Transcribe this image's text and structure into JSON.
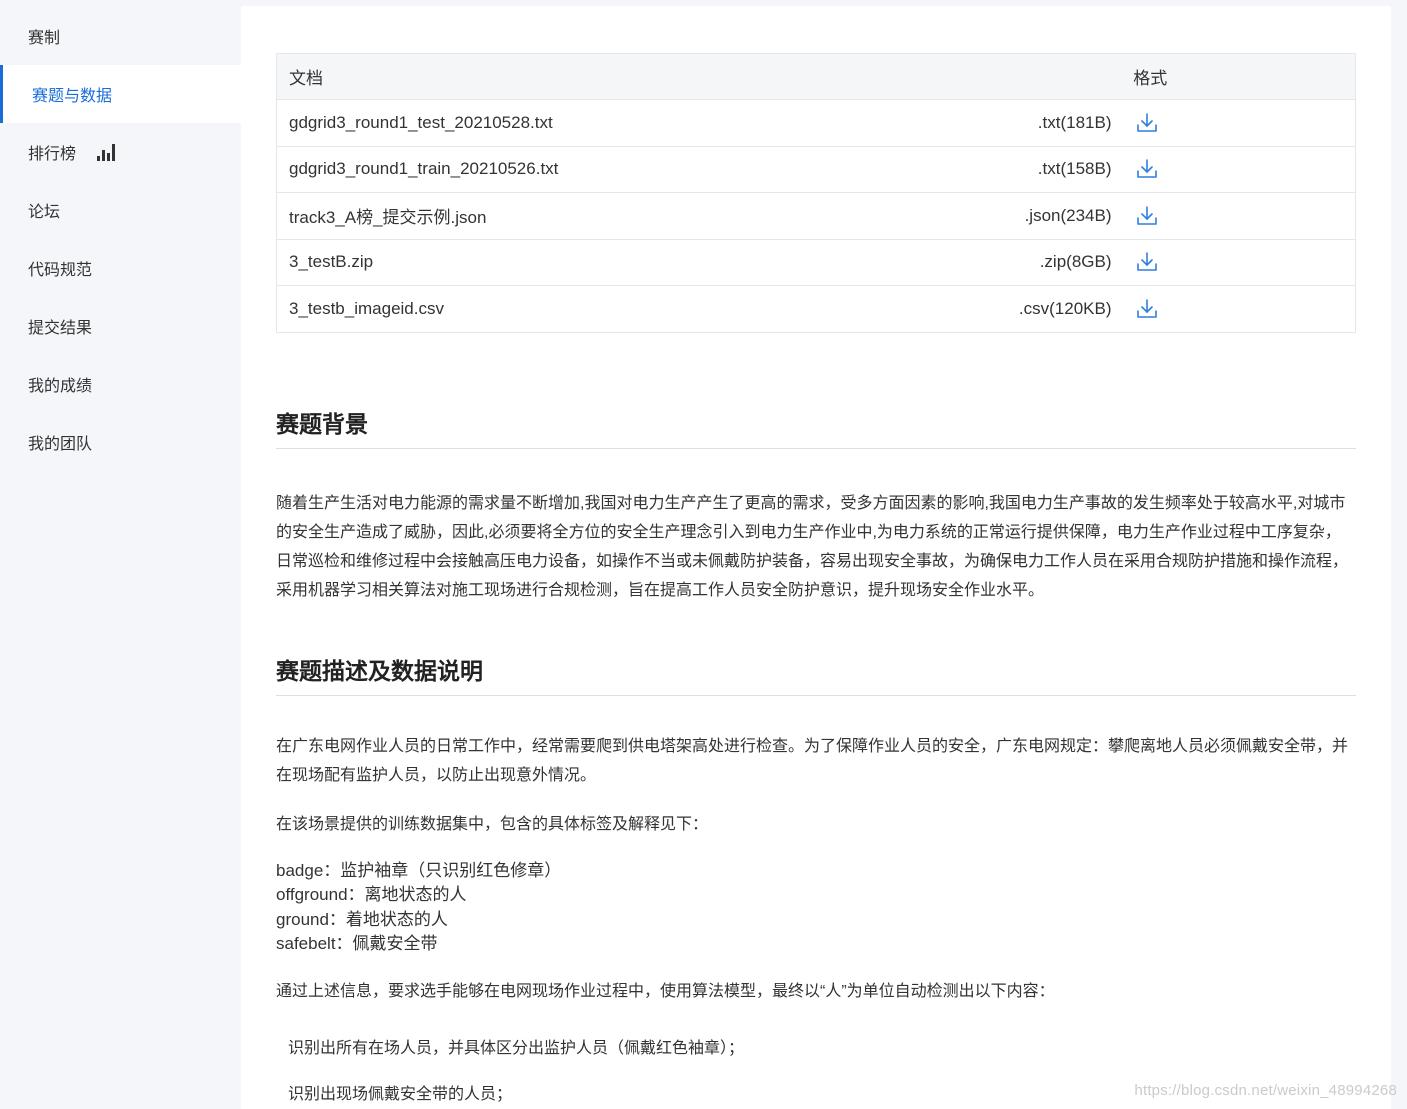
{
  "sidebar": {
    "items": [
      {
        "label": "赛制"
      },
      {
        "label": "赛题与数据"
      },
      {
        "label": "排行榜"
      },
      {
        "label": "论坛"
      },
      {
        "label": "代码规范"
      },
      {
        "label": "提交结果"
      },
      {
        "label": "我的成绩"
      },
      {
        "label": "我的团队"
      }
    ],
    "active_index": 1,
    "accent_color": "#1a6dd8"
  },
  "files_table": {
    "headers": {
      "doc": "文档",
      "format": "格式"
    },
    "rows": [
      {
        "name": "gdgrid3_round1_test_20210528.txt",
        "format": ".txt(181B)"
      },
      {
        "name": "gdgrid3_round1_train_20210526.txt",
        "format": ".txt(158B)"
      },
      {
        "name": "track3_A榜_提交示例.json",
        "format": ".json(234B)"
      },
      {
        "name": "3_testB.zip",
        "format": ".zip(8GB)"
      },
      {
        "name": "3_testb_imageid.csv",
        "format": ".csv(120KB)"
      }
    ],
    "download_icon": "download-icon"
  },
  "background": {
    "heading": "赛题背景",
    "text": "随着生产生活对电力能源的需求量不断增加,我国对电力生产产生了更高的需求，受多方面因素的影响,我国电力生产事故的发生频率处于较高水平,对城市的安全生产造成了威胁，因此,必须要将全方位的安全生产理念引入到电力生产作业中,为电力系统的正常运行提供保障，电力生产作业过程中工序复杂，日常巡检和维修过程中会接触高压电力设备，如操作不当或未佩戴防护装备，容易出现安全事故，为确保电力工作人员在采用合规防护措施和操作流程，采用机器学习相关算法对施工现场进行合规检测，旨在提高工作人员安全防护意识，提升现场安全作业水平。"
  },
  "description": {
    "heading": "赛题描述及数据说明",
    "para1": "在广东电网作业人员的日常工作中，经常需要爬到供电塔架高处进行检查。为了保障作业人员的安全，广东电网规定：攀爬离地人员必须佩戴安全带，并在现场配有监护人员，以防止出现意外情况。",
    "para2": "在该场景提供的训练数据集中，包含的具体标签及解释见下：",
    "labels": [
      "badge：监护袖章（只识别红色修章）",
      "offground：离地状态的人",
      "ground：着地状态的人",
      "safebelt：佩戴安全带"
    ],
    "para3": "通过上述信息，要求选手能够在电网现场作业过程中，使用算法模型，最终以“人”为单位自动检测出以下内容：",
    "items": [
      "识别出所有在场人员，并具体区分出监护人员（佩戴红色袖章）；",
      "识别出现场佩戴安全带的人员；"
    ]
  },
  "watermark": "https://blog.csdn.net/weixin_48994268"
}
